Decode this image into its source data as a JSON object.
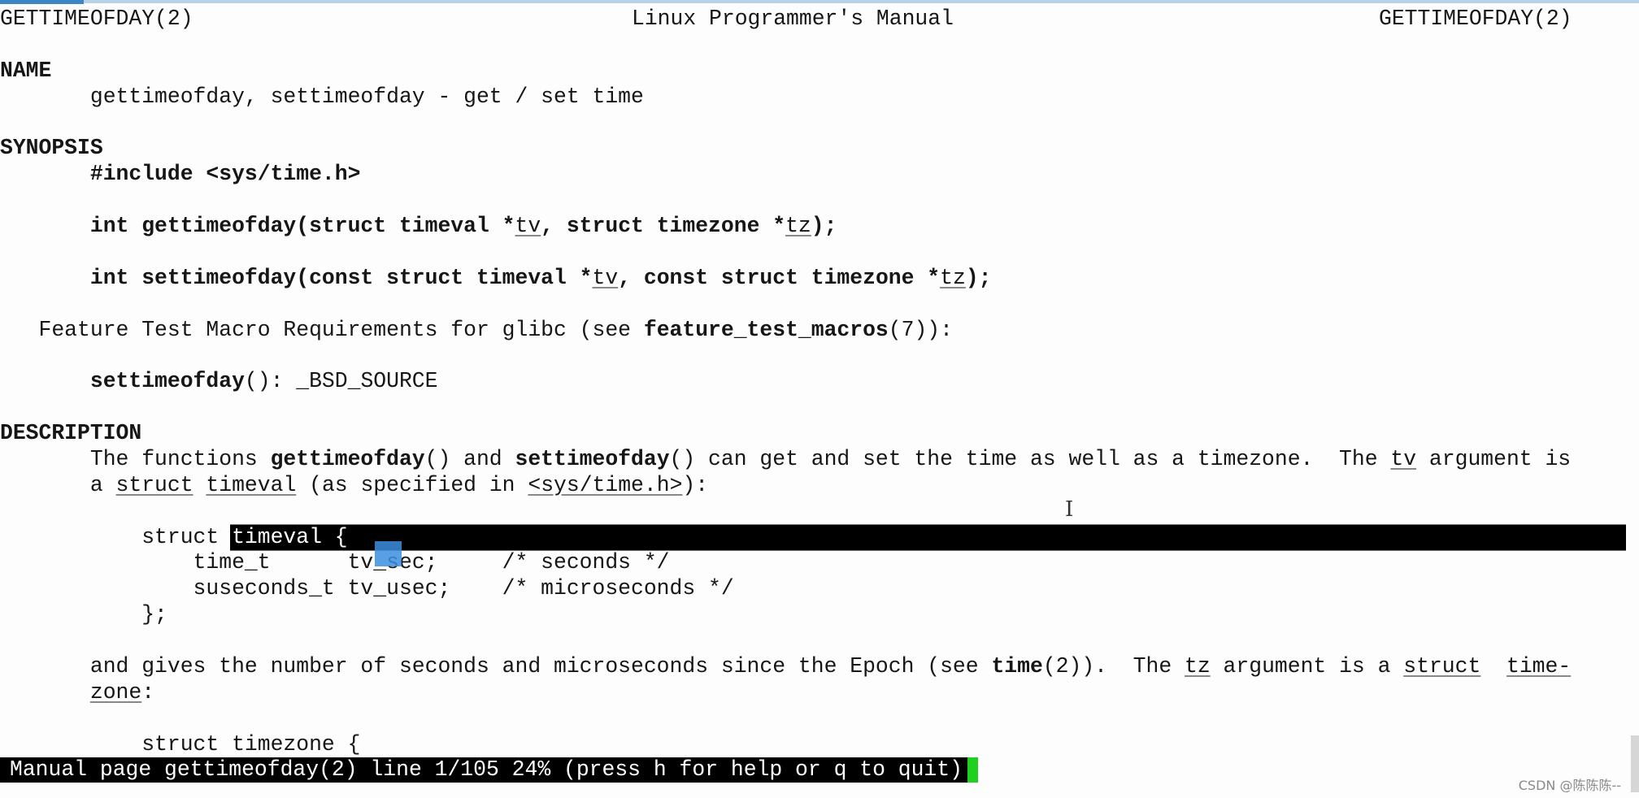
{
  "header": {
    "left": "GETTIMEOFDAY(2)",
    "center": "Linux Programmer's Manual",
    "right": "GETTIMEOFDAY(2)"
  },
  "lines": [
    [],
    [],
    [
      {
        "t": "NAME",
        "s": "b"
      }
    ],
    [
      {
        "t": "       gettimeofday, settimeofday - get / set time",
        "s": ""
      }
    ],
    [],
    [
      {
        "t": "SYNOPSIS",
        "s": "b"
      }
    ],
    [
      {
        "t": "       ",
        "s": ""
      },
      {
        "t": "#include <sys/time.h>",
        "s": "b"
      }
    ],
    [],
    [
      {
        "t": "       ",
        "s": ""
      },
      {
        "t": "int gettimeofday(struct timeval *",
        "s": "b"
      },
      {
        "t": "tv",
        "s": "u"
      },
      {
        "t": ", struct timezone *",
        "s": "b"
      },
      {
        "t": "tz",
        "s": "u"
      },
      {
        "t": ");",
        "s": "b"
      }
    ],
    [],
    [
      {
        "t": "       ",
        "s": ""
      },
      {
        "t": "int settimeofday(const struct timeval *",
        "s": "b"
      },
      {
        "t": "tv",
        "s": "u"
      },
      {
        "t": ", const struct timezone *",
        "s": "b"
      },
      {
        "t": "tz",
        "s": "u"
      },
      {
        "t": ");",
        "s": "b"
      }
    ],
    [],
    [
      {
        "t": "   Feature Test Macro Requirements for glibc (see ",
        "s": ""
      },
      {
        "t": "feature_test_macros",
        "s": "b"
      },
      {
        "t": "(7)):",
        "s": ""
      }
    ],
    [],
    [
      {
        "t": "       ",
        "s": ""
      },
      {
        "t": "settimeofday",
        "s": "b"
      },
      {
        "t": "(): _BSD_SOURCE",
        "s": ""
      }
    ],
    [],
    [
      {
        "t": "DESCRIPTION",
        "s": "b"
      }
    ],
    [
      {
        "t": "       The functions ",
        "s": ""
      },
      {
        "t": "gettimeofday",
        "s": "b"
      },
      {
        "t": "() and ",
        "s": ""
      },
      {
        "t": "settimeofday",
        "s": "b"
      },
      {
        "t": "() can get and set the time as well as a timezone.  The ",
        "s": ""
      },
      {
        "t": "tv",
        "s": "u"
      },
      {
        "t": " argument is",
        "s": ""
      }
    ],
    [
      {
        "t": "       a ",
        "s": ""
      },
      {
        "t": "struct",
        "s": "u"
      },
      {
        "t": " ",
        "s": ""
      },
      {
        "t": "timeval",
        "s": "u"
      },
      {
        "t": " (as specified in ",
        "s": ""
      },
      {
        "t": "<sys/time.h>",
        "s": "u"
      },
      {
        "t": "):",
        "s": ""
      }
    ],
    [],
    [
      {
        "t": "           struct ",
        "s": ""
      },
      {
        "t": "timeval {",
        "s": "hl"
      }
    ],
    [
      {
        "t": "               time_t      tv_sec;     /* seconds */",
        "s": ""
      }
    ],
    [
      {
        "t": "               suseconds_t tv_usec;    /* microseconds */",
        "s": ""
      }
    ],
    [
      {
        "t": "           };",
        "s": ""
      }
    ],
    [],
    [
      {
        "t": "       and gives the number of seconds and microseconds since the Epoch (see ",
        "s": ""
      },
      {
        "t": "time",
        "s": "b"
      },
      {
        "t": "(2)).  The ",
        "s": ""
      },
      {
        "t": "tz",
        "s": "u"
      },
      {
        "t": " argument is a ",
        "s": ""
      },
      {
        "t": "struct",
        "s": "u"
      },
      {
        "t": "  ",
        "s": ""
      },
      {
        "t": "time-",
        "s": "u"
      }
    ],
    [
      {
        "t": "       ",
        "s": ""
      },
      {
        "t": "zone",
        "s": "u"
      },
      {
        "t": ":",
        "s": ""
      }
    ],
    [],
    [
      {
        "t": "           struct timezone {",
        "s": ""
      }
    ]
  ],
  "status": "Manual page gettimeofday(2) line 1/105 24% (press h for help or q to quit)",
  "watermark": "CSDN @陈陈陈--",
  "colors": {
    "highlight": "#000000",
    "status_bg": "#000000",
    "status_cursor": "#1fd11f",
    "mouse_cursor_box": "#3b8ee0"
  }
}
